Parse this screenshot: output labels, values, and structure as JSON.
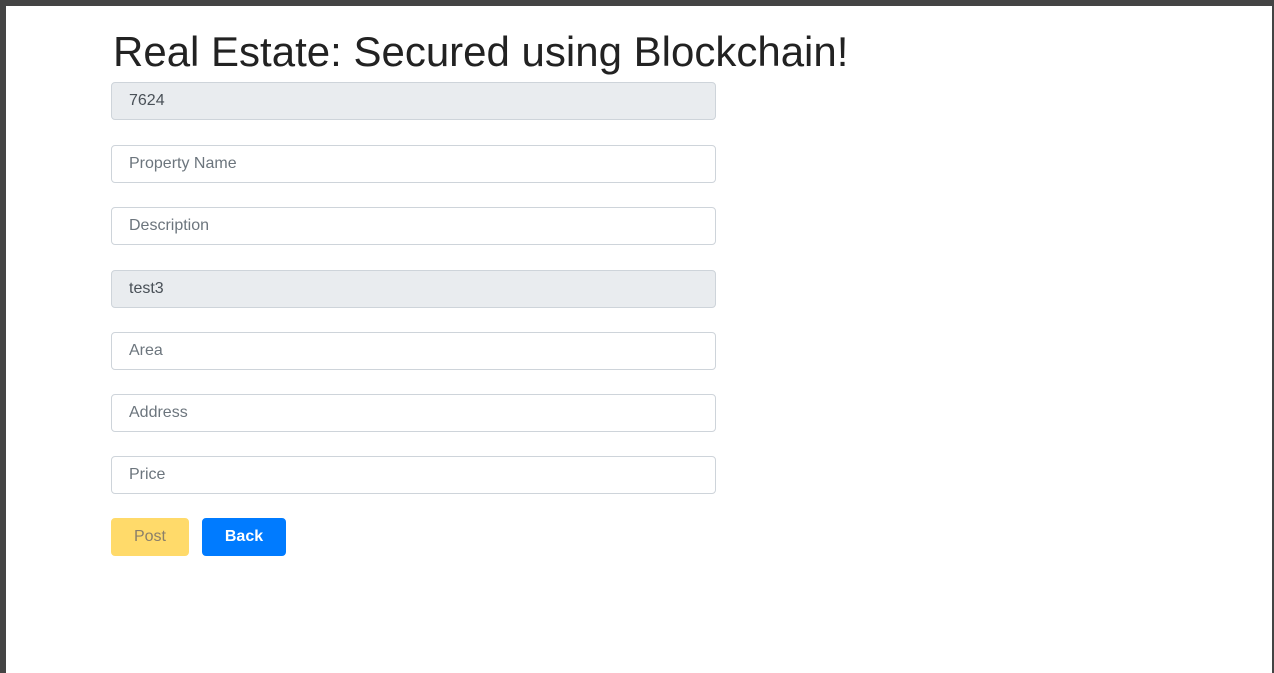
{
  "page": {
    "title": "Real Estate: Secured using Blockchain!"
  },
  "form": {
    "id_value": "7624",
    "property_name_placeholder": "Property Name",
    "description_placeholder": "Description",
    "owner_value": "test3",
    "area_placeholder": "Area",
    "address_placeholder": "Address",
    "price_placeholder": "Price"
  },
  "actions": {
    "post_label": "Post",
    "back_label": "Back"
  },
  "colors": {
    "post_button": "#ffda6a",
    "back_button": "#007bff",
    "readonly_field": "#e9ecef",
    "window_border": "#444444"
  }
}
